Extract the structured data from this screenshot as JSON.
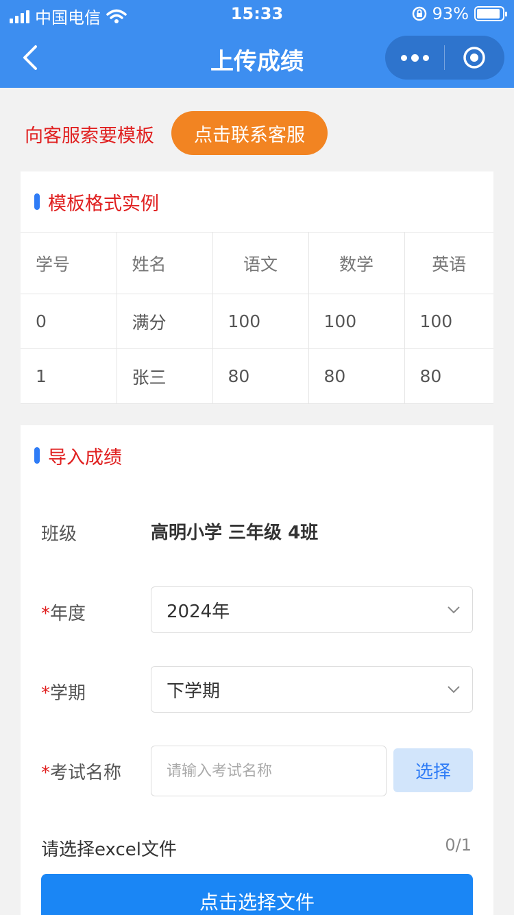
{
  "status_bar": {
    "carrier": "中国电信",
    "time": "15:33",
    "battery": "93%",
    "battery_level": 0.93
  },
  "nav": {
    "title": "上传成绩"
  },
  "contact": {
    "prompt": "向客服索要模板",
    "button": "点击联系客服"
  },
  "template_section": {
    "title": "模板格式实例",
    "headers": [
      "学号",
      "姓名",
      "语文",
      "数学",
      "英语"
    ],
    "rows": [
      [
        "0",
        "满分",
        "100",
        "100",
        "100"
      ],
      [
        "1",
        "张三",
        "80",
        "80",
        "80"
      ]
    ]
  },
  "import_section": {
    "title": "导入成绩",
    "class_label": "班级",
    "class_value": "高明小学 三年级 4班",
    "required_mark": "*",
    "year_label": "年度",
    "year_value": "2024年",
    "term_label": "学期",
    "term_value": "下学期",
    "exam_label": "考试名称",
    "exam_placeholder": "请输入考试名称",
    "pick_button": "选择",
    "file_label": "请选择excel文件",
    "file_count": "0/1",
    "file_button": "点击选择文件"
  },
  "colors": {
    "brand_blue": "#3d8ef0",
    "accent_orange": "#f28422",
    "alert_red": "#e02020",
    "primary_button": "#1a86f5"
  }
}
